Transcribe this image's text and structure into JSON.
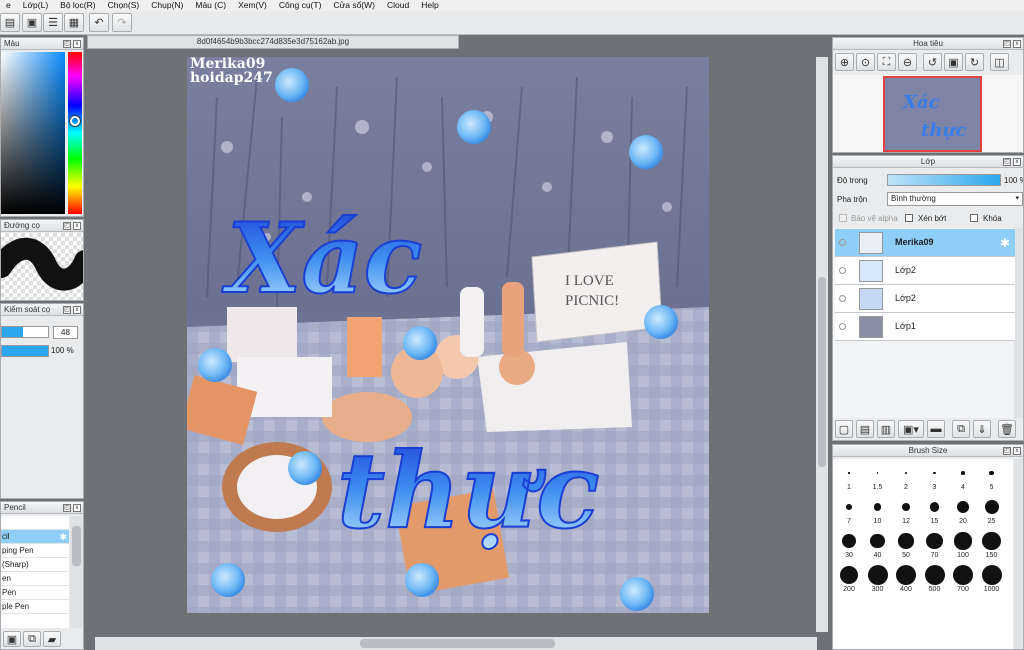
{
  "menu": [
    "e",
    "Lớp(L)",
    "Bộ lọc(R)",
    "Chọn(S)",
    "Chụp(N)",
    "Màu (C)",
    "Xem(V)",
    "Công cụ(T)",
    "Cửa sổ(W)",
    "Cloud",
    "Help"
  ],
  "document": {
    "filename": "8d0f4654b9b3bcc274d835e3d75162ab.jpg"
  },
  "artwork": {
    "watermark_line1": "Merika09",
    "watermark_line2": "hoidap247",
    "title_word1": "Xác",
    "title_word2": "thực",
    "sign_line1": "I LOVE",
    "sign_line2": "PICNIC!"
  },
  "left_panels": {
    "color_title": "Màu",
    "brush_stroke_title": "Đường cọ",
    "brush_ctrl_title": "Kiểm soát cọ",
    "brush_size_value": "48",
    "brush_opacity_value": "100 %",
    "brush_opacity_fraction": 1.0,
    "brush_size_fraction": 0.45,
    "tool_title": "Pencil",
    "tools": [
      "",
      "cil",
      "ping Pen",
      "(Sharp)",
      "en",
      "Pen",
      "ple Pen"
    ],
    "selected_tool_index": 1
  },
  "navigator": {
    "title": "Hoa tiêu"
  },
  "layers": {
    "title": "Lớp",
    "opacity_label": "Độ trong",
    "opacity_value": "100 %",
    "blend_label": "Pha trộn",
    "blend_value": "Bình thường",
    "protect_alpha": "Bảo vệ alpha",
    "clip": "Xén bớt",
    "lock": "Khóa",
    "items": [
      "Merika09",
      "Lớp2",
      "Lớp2",
      "Lớp1"
    ]
  },
  "brush_size_panel": {
    "title": "Brush Size",
    "sizes": [
      "1",
      "1.5",
      "2",
      "3",
      "4",
      "5",
      "7",
      "10",
      "12",
      "15",
      "20",
      "25",
      "30",
      "40",
      "50",
      "70",
      "100",
      "150",
      "200",
      "300",
      "400",
      "500",
      "700",
      "1000"
    ]
  },
  "colors": {
    "selection": "#8fcef7",
    "accent_blue": "#2a6fe0",
    "panel_bg": "#e9ebed"
  }
}
